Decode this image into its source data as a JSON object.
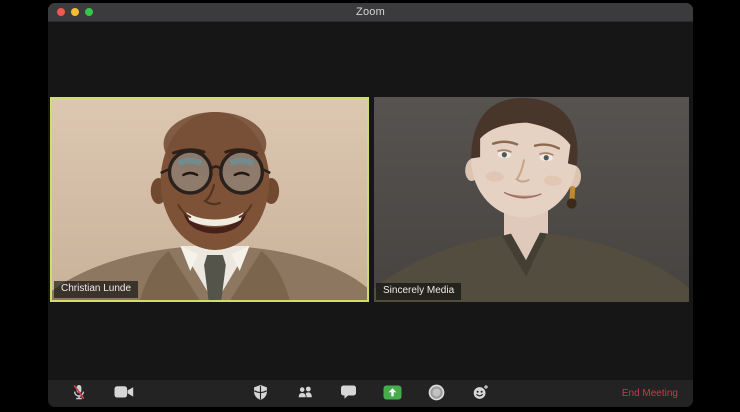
{
  "window": {
    "title": "Zoom"
  },
  "titlebar": {
    "controls": [
      "close",
      "minimize",
      "fullscreen"
    ]
  },
  "participants": [
    {
      "name": "Christian Lunde",
      "active_speaker": true,
      "description": "man with round glasses laughing, tweed jacket, beige background"
    },
    {
      "name": "Sincerely Media",
      "active_speaker": false,
      "description": "woman with short hair, olive top, gray background"
    }
  ],
  "toolbar": {
    "buttons": [
      "mute",
      "stop-video",
      "security",
      "participants",
      "chat",
      "share-screen",
      "record",
      "reactions"
    ],
    "mic_muted": true,
    "end_meeting_label": "End Meeting"
  },
  "colors": {
    "active_speaker_border": "#cede68",
    "share_screen_green": "#47ad4c",
    "end_meeting_red": "#c53b4d",
    "mute_slash_red": "#cc3e50",
    "titlebar_bg": "#3b3b3d",
    "toolbar_bg": "#232323",
    "content_bg": "#161616"
  }
}
